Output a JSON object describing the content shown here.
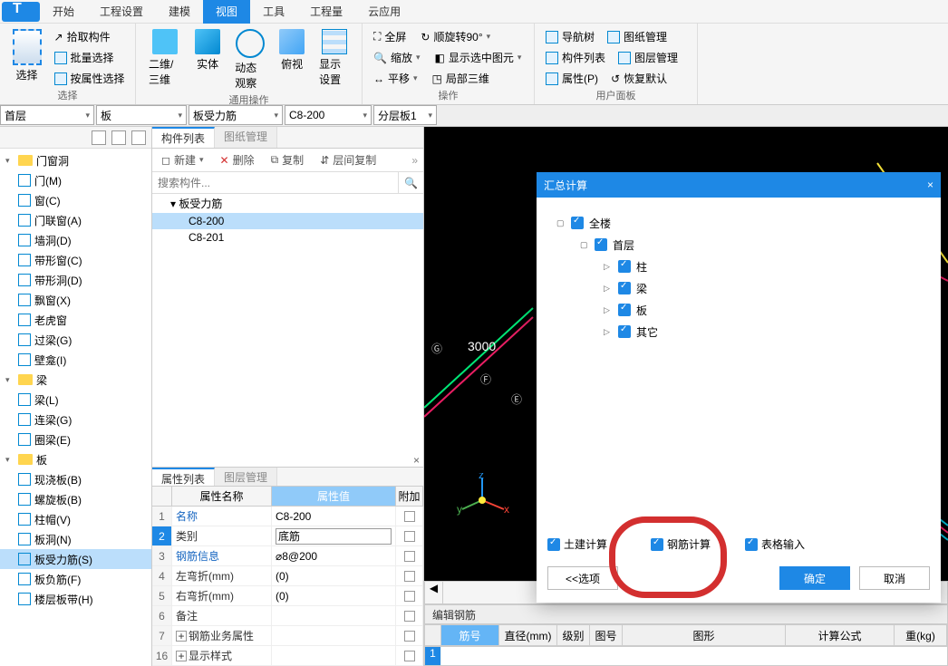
{
  "tabs": {
    "start": "开始",
    "proj": "工程设置",
    "model": "建模",
    "view": "视图",
    "tool": "工具",
    "qty": "工程量",
    "cloud": "云应用"
  },
  "ribbon": {
    "select": {
      "title": "选择",
      "big": "选择",
      "pick": "拾取构件",
      "batch": "批量选择",
      "byprop": "按属性选择"
    },
    "general": {
      "title": "通用操作",
      "v2d3d": "二维/三维",
      "solid": "实体",
      "dynob": "动态观察",
      "ortho": "俯视",
      "disp": "显示设置"
    },
    "oper": {
      "title": "操作",
      "full": "全屏",
      "rot": "顺旋转90°",
      "zoom": "缩放",
      "selshow": "显示选中图元",
      "pan": "平移",
      "local3d": "局部三维"
    },
    "user": {
      "title": "用户面板",
      "nav": "导航树",
      "drwmgr": "图纸管理",
      "complist": "构件列表",
      "layermgr": "图层管理",
      "prop": "属性(P)",
      "restore": "恢复默认"
    }
  },
  "dropdowns": {
    "floor": "首层",
    "cat": "板",
    "type": "板受力筋",
    "item": "C8-200",
    "layer": "分层板1"
  },
  "tree": {
    "g1": "门窗洞",
    "items1": [
      "门(M)",
      "窗(C)",
      "门联窗(A)",
      "墙洞(D)",
      "带形窗(C)",
      "带形洞(D)",
      "飘窗(X)",
      "老虎窗",
      "过梁(G)",
      "壁龛(I)"
    ],
    "g2": "梁",
    "items2": [
      "梁(L)",
      "连梁(G)",
      "圈梁(E)"
    ],
    "g3": "板",
    "items3": [
      "现浇板(B)",
      "螺旋板(B)",
      "柱帽(V)",
      "板洞(N)",
      "板受力筋(S)",
      "板负筋(F)",
      "楼层板带(H)"
    ],
    "sel": "板受力筋(S)"
  },
  "mid": {
    "tab1": "构件列表",
    "tab2": "图纸管理",
    "tb": {
      "new": "新建",
      "del": "删除",
      "copy": "复制",
      "intercopy": "层间复制"
    },
    "search": "搜索构件...",
    "root": "板受力筋",
    "i1": "C8-200",
    "i2": "C8-201"
  },
  "prop": {
    "tab1": "属性列表",
    "tab2": "图层管理",
    "h1": "属性名称",
    "h2": "属性值",
    "h3": "附加",
    "rows": [
      {
        "n": "1",
        "name": "名称",
        "val": "C8-200",
        "link": true
      },
      {
        "n": "2",
        "name": "类别",
        "val": "底筋",
        "sel": true,
        "input": true
      },
      {
        "n": "3",
        "name": "钢筋信息",
        "val": "⌀8@200",
        "link": true
      },
      {
        "n": "4",
        "name": "左弯折(mm)",
        "val": "(0)"
      },
      {
        "n": "5",
        "name": "右弯折(mm)",
        "val": "(0)"
      },
      {
        "n": "6",
        "name": "备注",
        "val": ""
      },
      {
        "n": "7",
        "name": "钢筋业务属性",
        "val": "",
        "exp": "+"
      },
      {
        "n": "16",
        "name": "显示样式",
        "val": "",
        "exp": "+"
      }
    ]
  },
  "view": {
    "dim": "3000",
    "editlabel": "编辑钢筋",
    "bh": {
      "num": "筋号",
      "dia": "直径(mm)",
      "lvl": "级别",
      "pic": "图号",
      "shape": "图形",
      "formula": "计算公式",
      "len": "重(kg)"
    }
  },
  "dialog": {
    "title": "汇总计算",
    "close": "×",
    "root": "全楼",
    "floor": "首层",
    "n1": "柱",
    "n2": "梁",
    "n3": "板",
    "n4": "其它",
    "cb1": "土建计算",
    "cb2": "钢筋计算",
    "cb3": "表格输入",
    "opt": "<<选项",
    "ok": "确定",
    "cancel": "取消"
  }
}
